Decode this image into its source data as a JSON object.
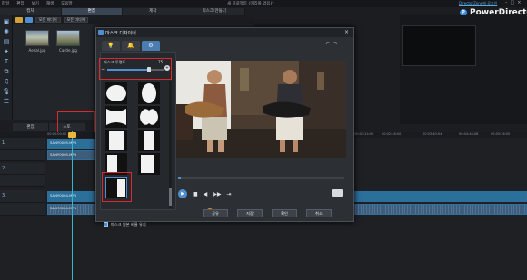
{
  "app": {
    "menu": [
      "파일",
      "편집",
      "보기",
      "재생",
      "도움말"
    ],
    "window_title": "새 프로젝트 (미리볼 없음)*",
    "brand_link": "DirectorZone에 로그인",
    "brand_name": "PowerDirector",
    "window_controls": [
      "–",
      "□",
      "×"
    ]
  },
  "mode_tabs": [
    "캡처",
    "편집",
    "제작",
    "디스크 만들기"
  ],
  "library": {
    "filter_label": "모든 미디어",
    "sort_label": "모든 미디어",
    "thumbnails": [
      {
        "label": "Aerial.jpg"
      },
      {
        "label": "Castle.jpg"
      }
    ]
  },
  "panel_tabs": [
    "편집",
    "스토"
  ],
  "ruler_ticks": [
    "00:00:00:00",
    "00:01:24:00",
    "00:02:48:00",
    "00:03:40:04",
    "00:04:48:08",
    "00:05:36:00",
    "00:07:00:00"
  ],
  "tracks": [
    {
      "label": "1.",
      "clip": "SANY0005.MP4"
    },
    {
      "label": "",
      "clip": "SANY0005.MP4"
    },
    {
      "label": "2.",
      "clip": ""
    },
    {
      "label": "",
      "clip": ""
    },
    {
      "label": "3.",
      "clip": "SANY0004.MP4"
    },
    {
      "label": "",
      "clip": "SANY0004.MP4"
    }
  ],
  "dialog": {
    "title": "마스크 디자이너",
    "close": "×",
    "tabs": [
      "💡",
      "🔔",
      "⚙"
    ],
    "undo": "↶",
    "redo": "↷",
    "opacity_label": "마스크 투명도",
    "opacity_value": "75",
    "opacity_percent": 75,
    "minus": "−",
    "plus": "+",
    "checkbox_label": "마스크 원본 비율 유지",
    "buttons": [
      "공유",
      "저장",
      "확인",
      "취소"
    ],
    "controls": {
      "play": "▶",
      "stop": "■",
      "prev": "◀",
      "next": "▶▶",
      "end": "⇥"
    }
  }
}
